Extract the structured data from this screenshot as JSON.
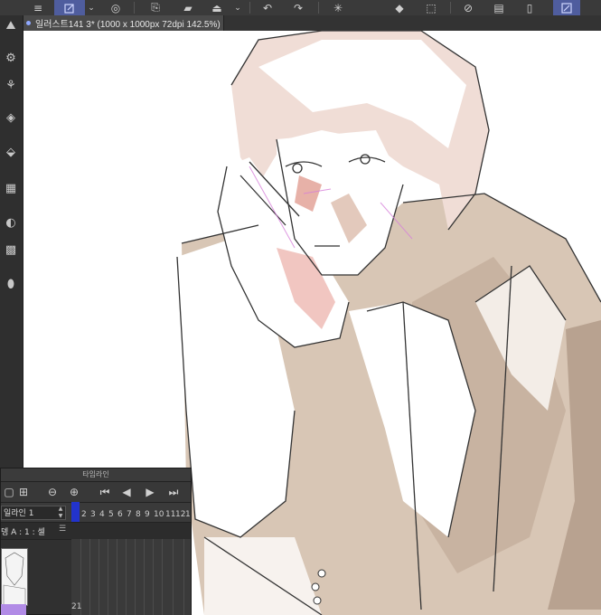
{
  "toolbar": {
    "items": [
      "menu-icon",
      "pen-icon",
      "chevron-down-icon",
      "spiral-icon",
      "add-layer-icon",
      "folder-icon",
      "save-icon",
      "chevron-down-icon",
      "undo-icon",
      "redo-icon",
      "spinner-icon",
      "fill-icon",
      "transform-icon",
      "clear-icon",
      "layer-icon",
      "sticky-icon",
      "select-tool-icon"
    ]
  },
  "document_tab": {
    "title": "일러스트141 3* (1000 x 1000px 72dpi 142.5%)"
  },
  "left_tools": [
    "sub-tool-icon",
    "settings-icon",
    "layers-icon",
    "layer-property-icon",
    "grid-icon",
    "navigator-icon",
    "material-icon",
    "color-icon"
  ],
  "timeline": {
    "title": "타임라인",
    "track_name": "일라인 1",
    "layer_label": "뎅 A : 1 : 셀",
    "frames": [
      "1",
      "2",
      "3",
      "4",
      "5",
      "6",
      "7",
      "8",
      "9",
      "10",
      "11",
      "12",
      "1"
    ],
    "current_frame": "1",
    "lower_frame": "21",
    "thumb_accent": "#b18be6",
    "cursor_color": "#2233cc"
  },
  "colors": {
    "accent": "#4f5d9e",
    "canvas": "#ffffff",
    "shade": "#cdb9a8"
  }
}
